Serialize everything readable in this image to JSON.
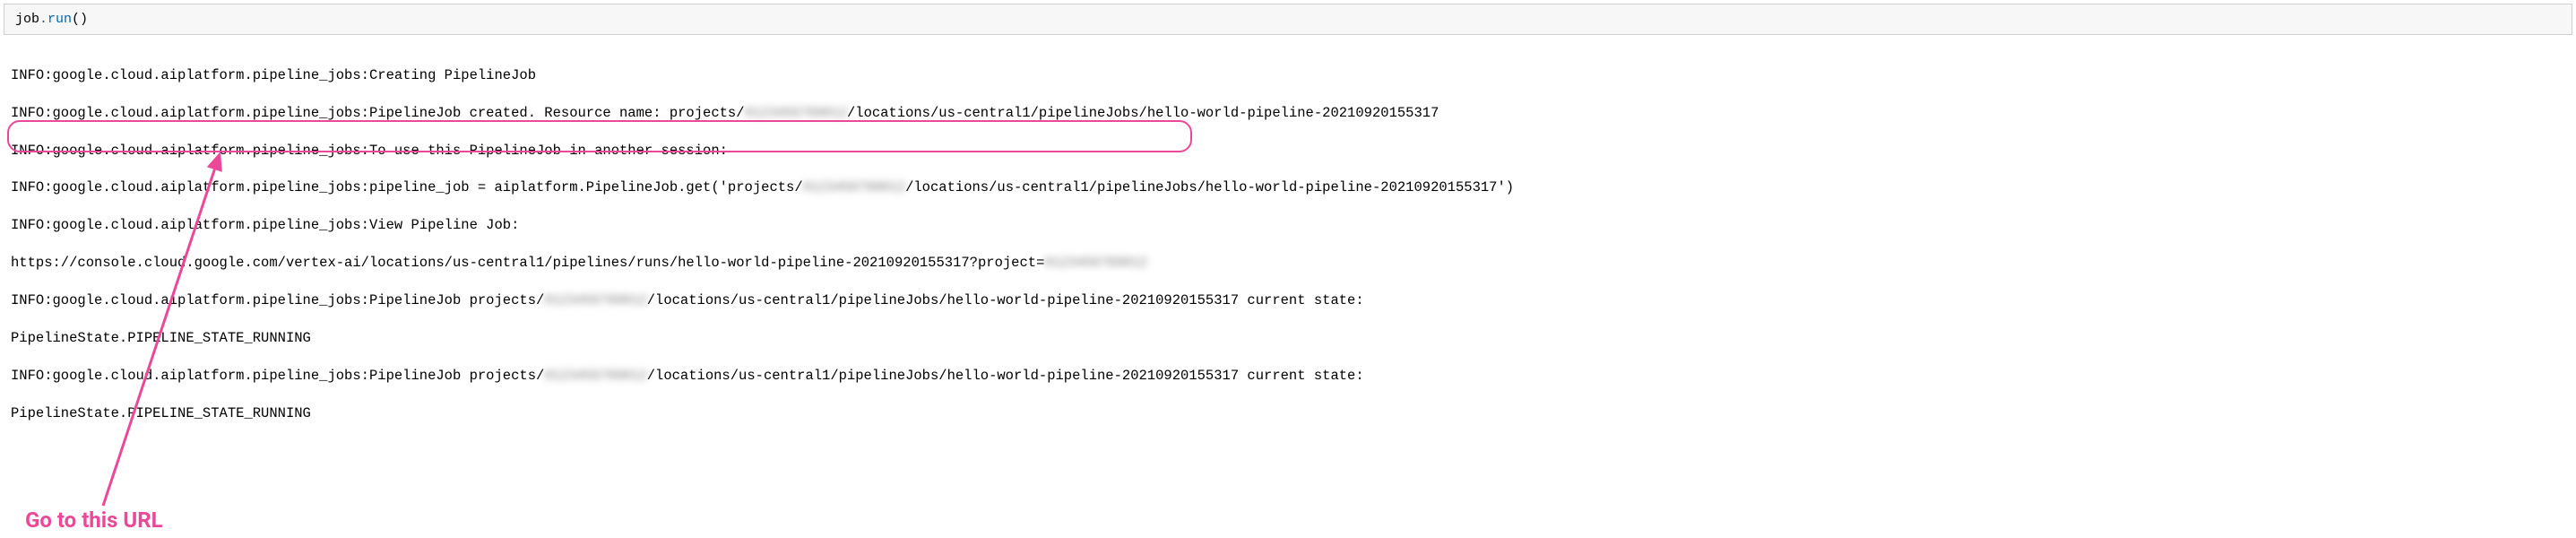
{
  "code_cell": {
    "obj": "job",
    "dot": ".",
    "method": "run",
    "parens": "()"
  },
  "output": {
    "lines": [
      "INFO:google.cloud.aiplatform.pipeline_jobs:Creating PipelineJob",
      "INFO:google.cloud.aiplatform.pipeline_jobs:PipelineJob created. Resource name: projects/",
      "/locations/us-central1/pipelineJobs/hello-world-pipeline-20210920155317",
      "INFO:google.cloud.aiplatform.pipeline_jobs:To use this PipelineJob in another session:",
      "INFO:google.cloud.aiplatform.pipeline_jobs:pipeline_job = aiplatform.PipelineJob.get('projects/",
      "/locations/us-central1/pipelineJobs/hello-world-pipeline-20210920155317')",
      "INFO:google.cloud.aiplatform.pipeline_jobs:View Pipeline Job:",
      "https://console.cloud.google.com/vertex-ai/locations/us-central1/pipelines/runs/hello-world-pipeline-20210920155317?project=",
      "INFO:google.cloud.aiplatform.pipeline_jobs:PipelineJob projects/",
      "/locations/us-central1/pipelineJobs/hello-world-pipeline-20210920155317 current state:",
      "PipelineState.PIPELINE_STATE_RUNNING",
      "INFO:google.cloud.aiplatform.pipeline_jobs:PipelineJob projects/",
      "/locations/us-central1/pipelineJobs/hello-world-pipeline-20210920155317 current state:",
      "PipelineState.PIPELINE_STATE_RUNNING"
    ],
    "redacted_placeholder": "0123456789012"
  },
  "annotation": {
    "label": "Go to this URL",
    "color": "#ec4899"
  }
}
